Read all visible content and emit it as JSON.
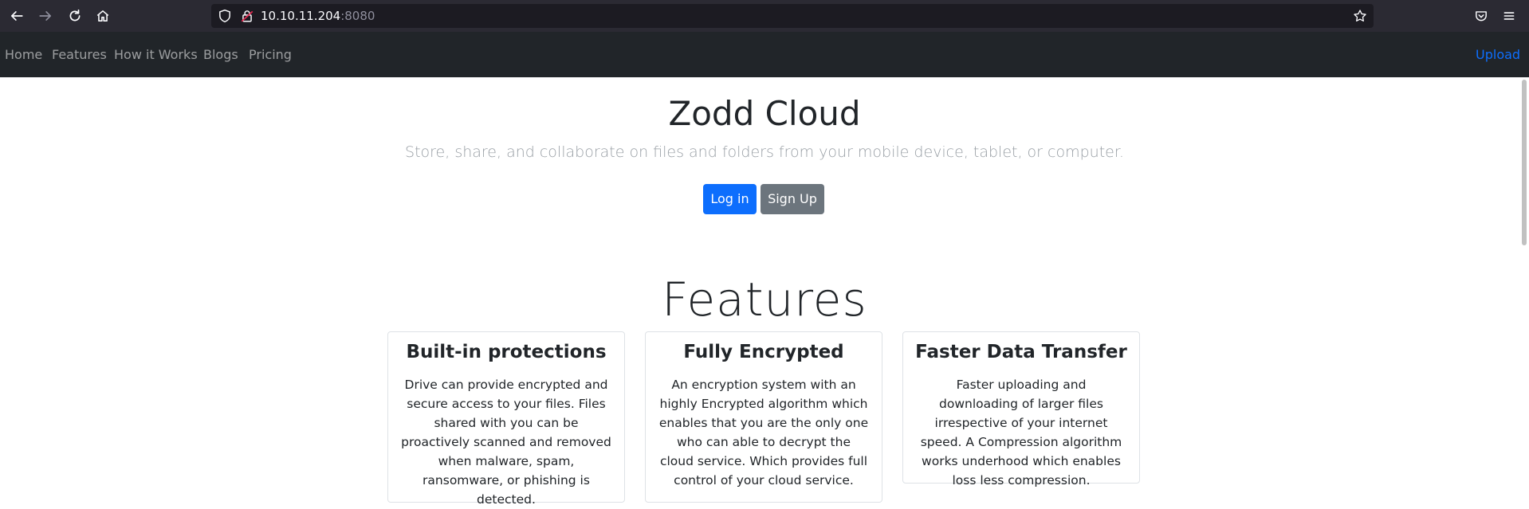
{
  "browser": {
    "url_host": "10.10.11.204",
    "url_port": ":8080"
  },
  "nav": {
    "items": [
      "Home",
      "Features",
      "How it Works",
      "Blogs",
      "Pricing"
    ],
    "upload": "Upload"
  },
  "hero": {
    "title": "Zodd Cloud",
    "subtitle": "Store, share, and collaborate on files and folders from your mobile device, tablet, or computer.",
    "login": "Log in",
    "signup": "Sign Up"
  },
  "features": {
    "title": "Features",
    "cards": [
      {
        "title": "Built-in protections",
        "text": "Drive can provide encrypted and secure access to your files. Files shared with you can be proactively scanned and removed when malware, spam, ransomware, or phishing is detected."
      },
      {
        "title": "Fully Encrypted",
        "text": "An encryption system with an highly Encrypted algorithm which enables that you are the only one who can able to decrypt the cloud service. Which provides full control of your cloud service."
      },
      {
        "title": "Faster Data Transfer",
        "text": "Faster uploading and downloading of larger files irrespective of your internet speed. A Compression algorithm works underhood which enables loss less compression."
      }
    ]
  },
  "colors": {
    "navbar_bg": "#212529",
    "primary": "#0d6efd",
    "secondary": "#6c757d",
    "browser_bg": "#2b2a33"
  }
}
